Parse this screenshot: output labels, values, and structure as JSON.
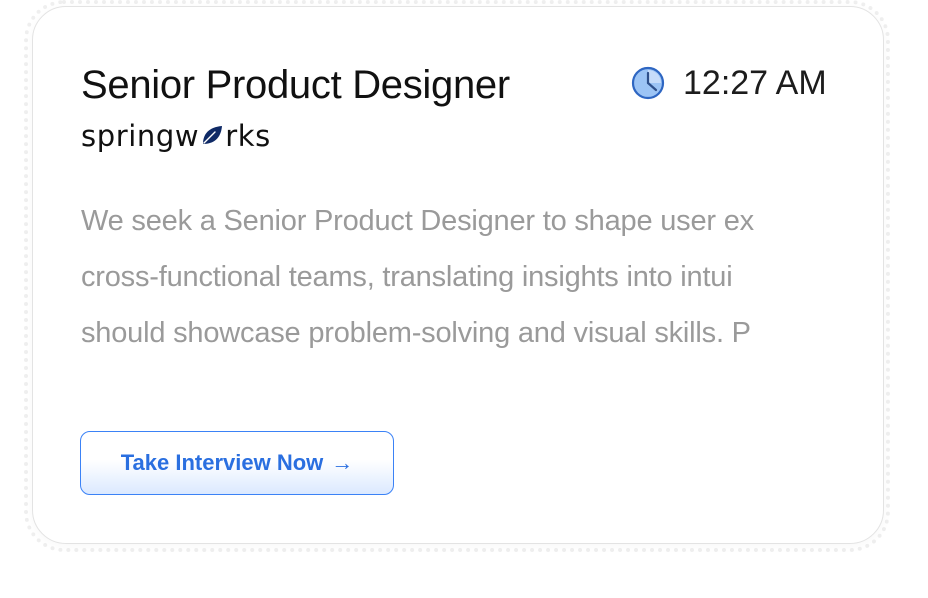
{
  "job": {
    "title": "Senior Product Designer",
    "company": {
      "prefix": "springw",
      "suffix": "rks",
      "brand_color": "#0f2a66"
    },
    "time": "12:27 AM",
    "description_lines": [
      "We seek a Senior Product Designer to shape user ex",
      "cross-functional teams, translating insights into intui",
      "should showcase problem-solving and visual skills. P"
    ]
  },
  "cta": {
    "label": "Take Interview Now",
    "arrow": "→",
    "accent_color": "#2a6fe0"
  },
  "icons": {
    "clock": "clock-icon",
    "logo_leaf": "leaf-icon"
  }
}
